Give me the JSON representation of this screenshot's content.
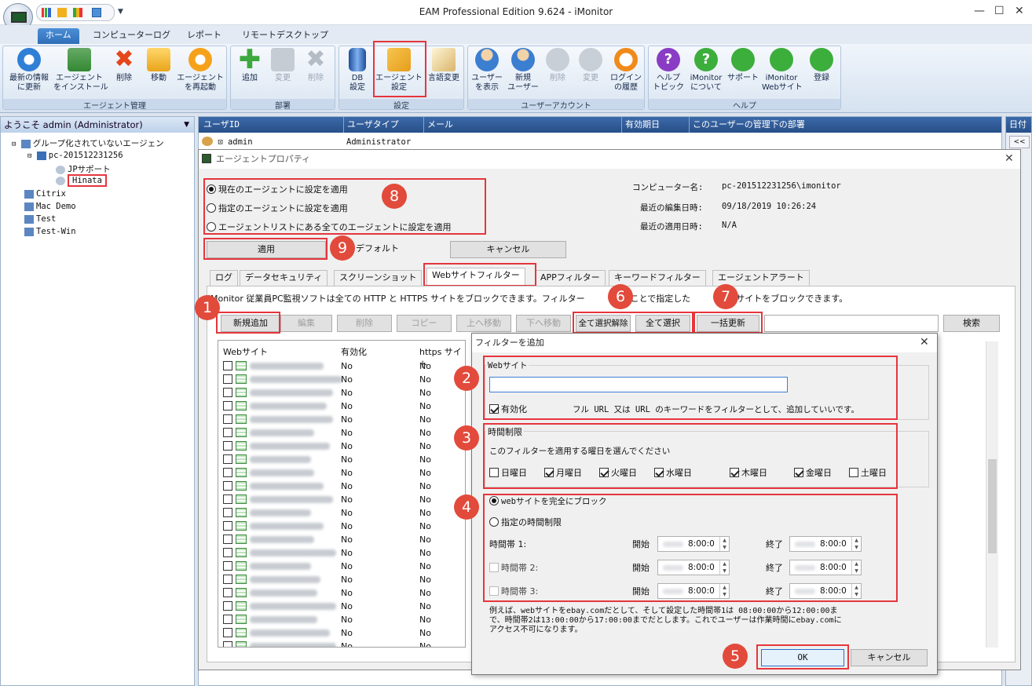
{
  "window": {
    "title": "EAM Professional Edition 9.624 - iMonitor",
    "minimize": "—",
    "maximize": "☐",
    "close": "✕"
  },
  "ribbon_tabs": [
    "ホーム",
    "コンピューターログ",
    "レポート",
    "リモートデスクトップ"
  ],
  "ribbon": {
    "agent_group": {
      "label": "エージェント管理",
      "buttons": [
        "最新の情報\nに更新",
        "エージェント\nをインストール",
        "削除",
        "移動",
        "エージェント\nを再起動"
      ]
    },
    "dept_group": {
      "label": "部署",
      "buttons": [
        "追加",
        "変更",
        "削除"
      ]
    },
    "settings_group": {
      "label": "設定",
      "buttons": [
        "DB\n設定",
        "エージェント\n設定",
        "言語変更"
      ]
    },
    "user_group": {
      "label": "ユーザーアカウント",
      "buttons": [
        "ユーザー\nを表示",
        "新規\nユーザー",
        "削除",
        "変更",
        "ログイン\nの履歴"
      ]
    },
    "help_group": {
      "label": "ヘルプ",
      "buttons": [
        "ヘルプ\nトピック",
        "iMonitor\nについて",
        "サポート",
        "iMonitor\nWebサイト",
        "登録"
      ]
    }
  },
  "left_panel": {
    "welcome": "ようこそ admin (Administrator)",
    "tree": [
      {
        "label": "グループ化されていないエージェン",
        "level": 0
      },
      {
        "label": "pc-201512231256",
        "level": 1
      },
      {
        "label": "JPサポート",
        "level": 2
      },
      {
        "label": "Hinata",
        "level": 2
      },
      {
        "label": "Citrix",
        "level": 0
      },
      {
        "label": "Mac Demo",
        "level": 0
      },
      {
        "label": "Test",
        "level": 0
      },
      {
        "label": "Test-Win",
        "level": 0
      }
    ]
  },
  "user_list": {
    "headers": [
      "ユーザID",
      "ユーザタイプ",
      "メール",
      "有効期日",
      "このユーザーの管理下の部署"
    ],
    "row": {
      "user": "admin",
      "type": "Administrator"
    }
  },
  "right_strip": {
    "label": "日付",
    "nav": "<<"
  },
  "agent_dialog": {
    "title": "エージェントプロパティ",
    "apply_options": [
      "現在のエージェントに設定を適用",
      "指定のエージェントに設定を適用",
      "エージェントリストにある全てのエージェントに設定を適用"
    ],
    "info": [
      {
        "label": "コンピューター名:",
        "value": "pc-201512231256\\imonitor"
      },
      {
        "label": "最近の編集日時:",
        "value": "09/18/2019 10:26:24"
      },
      {
        "label": "最近の適用日時:",
        "value": "N/A"
      }
    ],
    "buttons": {
      "apply": "適用",
      "default": "デフォルト",
      "cancel": "キャンセル"
    },
    "tabs": [
      "ログ",
      "データセキュリティ",
      "スクリーンショット",
      "Webサイトフィルター",
      "APPフィルター",
      "キーワードフィルター",
      "エージェントアラート"
    ],
    "description": "iMonitor 従業員PC監視ソフトは全ての HTTP と HTTPS サイトをブロックできます。フィルター",
    "description_tail": "することで指定した",
    "description_end": "特定サイトをブロックできます。",
    "toolbar": [
      "新規追加",
      "編集",
      "削除",
      "コピー",
      "上へ移動",
      "下へ移動",
      "全て選択解除",
      "全て選択",
      "一括更新"
    ],
    "search": "検索",
    "grid_headers": [
      "Webサイト",
      "有効化",
      "https サイト"
    ],
    "grid_rows": [
      {
        "site": "hotmail.com",
        "enabled": "No",
        "https": "No"
      },
      {
        "site": "mail.cn.yahoo.com",
        "enabled": "No",
        "https": "No"
      },
      {
        "site": "mail.yahoo.com",
        "enabled": "No",
        "https": "No"
      },
      {
        "site": "mail.tom.com",
        "enabled": "No",
        "https": "No"
      },
      {
        "site": "mail.sogou.com",
        "enabled": "No",
        "https": "No"
      },
      {
        "site": "eyou.com",
        "enabled": "No",
        "https": "No"
      },
      {
        "site": "mail.21cn.com",
        "enabled": "No",
        "https": "No"
      },
      {
        "site": "188.com",
        "enabled": "No",
        "https": "No"
      },
      {
        "site": "yeah.net",
        "enabled": "No",
        "https": "No"
      },
      {
        "site": "foxmail.com",
        "enabled": "No",
        "https": "No"
      },
      {
        "site": "mail.wo.com.cn",
        "enabled": "No",
        "https": "No"
      },
      {
        "site": "263.net",
        "enabled": "No",
        "https": "No"
      },
      {
        "site": "outlook.com",
        "enabled": "No",
        "https": "No"
      },
      {
        "site": "2980.com",
        "enabled": "No",
        "https": "No"
      },
      {
        "site": "mail.aliyun.com",
        "enabled": "No",
        "https": "No"
      },
      {
        "site": "115.com",
        "enabled": "No",
        "https": "No"
      },
      {
        "site": "kuaipan.cn",
        "enabled": "No",
        "https": "No"
      },
      {
        "site": "dbank.com",
        "enabled": "No",
        "https": "No"
      },
      {
        "site": "kuai.xunlei.com",
        "enabled": "No",
        "https": "No"
      },
      {
        "site": "weipan.cn",
        "enabled": "No",
        "https": "No"
      },
      {
        "site": "pan.baidu.com",
        "enabled": "No",
        "https": "No"
      },
      {
        "site": "vdisk.weibo.com",
        "enabled": "No",
        "https": "No"
      }
    ]
  },
  "filter_dialog": {
    "title": "フィルターを追加",
    "website_legend": "Webサイト",
    "url_value": "",
    "enable_label": "有効化",
    "hint": "フル URL 又は URL のキーワードをフィルターとして、追加していいです。",
    "time_legend": "時間制限",
    "days_prompt": "このフィルターを適用する曜日を選んでください",
    "days": [
      {
        "label": "日曜日",
        "checked": false
      },
      {
        "label": "月曜日",
        "checked": true
      },
      {
        "label": "火曜日",
        "checked": true
      },
      {
        "label": "水曜日",
        "checked": true
      },
      {
        "label": "木曜日",
        "checked": true
      },
      {
        "label": "金曜日",
        "checked": true
      },
      {
        "label": "土曜日",
        "checked": false
      }
    ],
    "block_all": "webサイトを完全にブロック",
    "time_limited": "指定の時間制限",
    "slots": [
      {
        "label": "時間帯 1:",
        "start_label": "開始",
        "start": "8:00:0",
        "end_label": "終了",
        "end": "8:00:0"
      },
      {
        "label": "時間帯 2:",
        "start_label": "開始",
        "start": "8:00:0",
        "end_label": "終了",
        "end": "8:00:0"
      },
      {
        "label": "時間帯 3:",
        "start_label": "開始",
        "start": "8:00:0",
        "end_label": "終了",
        "end": "8:00:0"
      }
    ],
    "example_1": "例えば、webサイトをebay.comだとして、そして設定した時間帯1は 08:00:00から12:00:00ま",
    "example_2": "で、時間帯2は13:00:00から17:00:00までだとします。これでユーザーは作業時間にebay.comに",
    "example_3": "アクセス不可になります。",
    "ok": "OK",
    "cancel": "キャンセル"
  },
  "callouts": [
    "1",
    "2",
    "3",
    "4",
    "5",
    "6",
    "7",
    "8",
    "9"
  ],
  "colors": {
    "accent": "#2f6fb8",
    "callout": "#e24a3b",
    "highlight_border": "#e5363c"
  }
}
